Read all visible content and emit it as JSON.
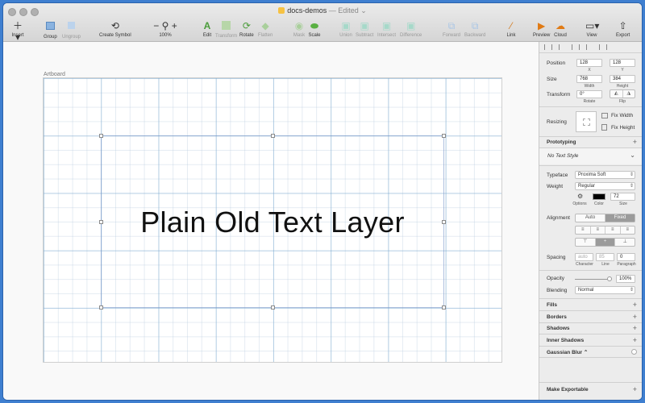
{
  "window": {
    "title": "docs-demos",
    "status": "— Edited ⌄"
  },
  "toolbar": {
    "insert": "Insert",
    "group": "Group",
    "ungroup": "Ungroup",
    "create_symbol": "Create Symbol",
    "zoom_out": "−",
    "zoom_in": "+",
    "zoom": "100%",
    "edit": "Edit",
    "transform": "Transform",
    "rotate": "Rotate",
    "flatten": "Flatten",
    "mask": "Mask",
    "scale": "Scale",
    "union": "Union",
    "subtract": "Subtract",
    "intersect": "Intersect",
    "difference": "Difference",
    "forward": "Forward",
    "backward": "Backward",
    "link": "Link",
    "preview": "Preview",
    "cloud": "Cloud",
    "view": "View",
    "export": "Export"
  },
  "canvas": {
    "artboard_label": "Artboard",
    "text_layer": "Plain Old Text Layer"
  },
  "inspector": {
    "position_label": "Position",
    "position_x": "128",
    "position_y": "128",
    "x_label": "X",
    "y_label": "Y",
    "size_label": "Size",
    "width": "768",
    "height": "384",
    "width_label": "Width",
    "height_label": "Height",
    "transform_label": "Transform",
    "rotate_value": "0°",
    "rotate_label": "Rotate",
    "flip_label": "Flip",
    "resizing_label": "Resizing",
    "fix_width": "Fix Width",
    "fix_height": "Fix Height",
    "prototyping": "Prototyping",
    "text_style": "No Text Style",
    "typeface_label": "Typeface",
    "typeface": "Proxima Soft",
    "weight_label": "Weight",
    "weight": "Regular",
    "options_label": "Options",
    "color_label": "Color",
    "size_value": "72",
    "size_sub_label": "Size",
    "alignment_label": "Alignment",
    "auto": "Auto",
    "fixed": "Fixed",
    "spacing_label": "Spacing",
    "character_ph": "auto",
    "line_ph": "85",
    "paragraph": "0",
    "character_label": "Character",
    "line_label": "Line",
    "paragraph_label": "Paragraph",
    "opacity_label": "Opacity",
    "opacity": "100%",
    "blending_label": "Blending",
    "blending": "Normal",
    "fills": "Fills",
    "borders": "Borders",
    "shadows": "Shadows",
    "inner_shadows": "Inner Shadows",
    "gaussian_blur": "Gaussian Blur ⌃",
    "make_exportable": "Make Exportable"
  }
}
